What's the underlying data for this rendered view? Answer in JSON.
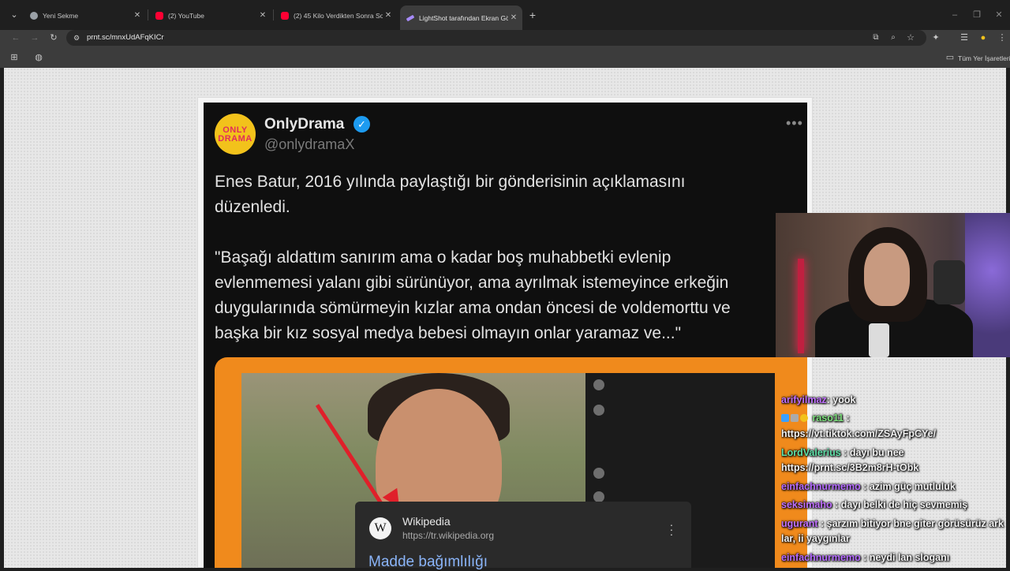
{
  "tabs": [
    {
      "title": "Yeni Sekme",
      "active": false,
      "favicon_color": "#9aa0a6"
    },
    {
      "title": "(2) YouTube",
      "active": false,
      "favicon_color": "#ff0033"
    },
    {
      "title": "(2) 45 Kilo Verdikten Sonra Sor...",
      "active": false,
      "favicon_color": "#ff0033"
    },
    {
      "title": "LightShot tarafından Ekran Görü...",
      "active": true,
      "favicon_color": "#a78bfa"
    }
  ],
  "toolbar": {
    "url": "prnt.sc/mnxUdAFqKICr"
  },
  "bookmarks": {
    "all_bookmarks_label": "Tüm Yer İşaretleri"
  },
  "tweet": {
    "avatar_line1": "ONLY",
    "avatar_line2": "DRAMA",
    "display_name": "OnlyDrama",
    "handle": "@onlydramaX",
    "more": "•••",
    "paragraph1_line1": "Enes Batur, 2016 yılında paylaştığı bir gönderisinin açıklamasını",
    "paragraph1_line2": "düzenledi.",
    "paragraph2_line1": "\"Başağı aldattım sanırım ama o kadar boş muhabbetki evlenip",
    "paragraph2_line2": "evlenmemesi yalanı gibi sürünüyor, ama ayrılmak istemeyince erkeğin",
    "paragraph2_line3": "duygularınıda sömürmeyin kızlar ama ondan öncesi de voldemorttu ve",
    "paragraph2_line4": "başka bir kız sosyal medya bebesi olmayın onlar yaramaz ve...\""
  },
  "wiki_popup": {
    "title": "Wikipedia",
    "url": "https://tr.wikipedia.org",
    "link": "Madde bağımlılığı"
  },
  "chat": [
    {
      "user": "arifyilmaz",
      "user_color": "#c070ff",
      "message": ": yook"
    },
    {
      "user": "raso11",
      "user_color": "#7ee07e",
      "message": " :",
      "badges": [
        "#3aa0ff",
        "#aaaaaa",
        "#f2c21b"
      ]
    },
    {
      "user": "",
      "user_color": "#ffffff",
      "message": "https://vt.tiktok.com/ZSAyFpCYe/"
    },
    {
      "user": "LordValerius",
      "user_color": "#5fe0a8",
      "message": " : dayı bu nee"
    },
    {
      "user": "",
      "user_color": "#ffffff",
      "message": "https://prnt.sc/3B2m8rH-tObk"
    },
    {
      "user": "einfachnurmemo",
      "user_color": "#b56cff",
      "message": " : azim güç mutluluk"
    },
    {
      "user": "seksimaho",
      "user_color": "#c070ff",
      "message": " : dayı belki de hiç sevmemiş"
    },
    {
      "user": "ugurant",
      "user_color": "#c070ff",
      "message": " : şarzım bitiyor bne giter görüsürüz ark"
    },
    {
      "user": "",
      "user_color": "#ffffff",
      "message": "lar, ii yaygınlar"
    },
    {
      "user": "einfachnurmemo",
      "user_color": "#b56cff",
      "message": " : neydi lan sloganı"
    }
  ],
  "colors": {
    "tab_bg": "#1f1f1f",
    "toolbar_bg": "#3c3c3c",
    "page_bg": "#e7e7e7",
    "tweet_bg": "#0f0f0f",
    "verified_blue": "#1d9bf0",
    "embed_orange": "#f08a1c",
    "wiki_link_blue": "#8ab4f8"
  },
  "icons": [
    "chevron-down-icon",
    "chrome-icon",
    "youtube-icon",
    "lightshot-icon",
    "close-icon",
    "new-tab-icon",
    "back-icon",
    "forward-icon",
    "reload-icon",
    "site-info-icon",
    "install-icon",
    "zoom-icon",
    "star-icon",
    "extensions-icon",
    "reading-list-icon",
    "profile-icon",
    "menu-icon",
    "apps-icon",
    "folder-icon"
  ]
}
